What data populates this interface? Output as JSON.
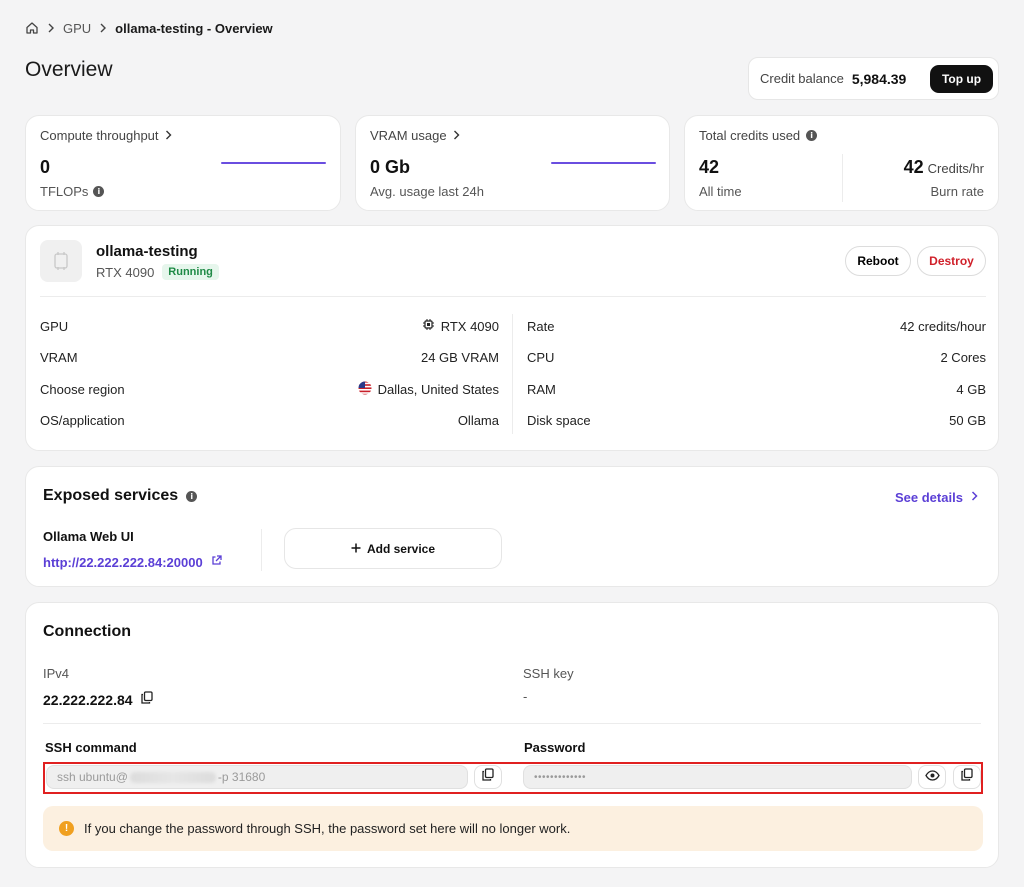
{
  "breadcrumb": {
    "home_icon": "home-icon",
    "level1": "GPU",
    "current": "ollama-testing - Overview"
  },
  "page_title": "Overview",
  "credit": {
    "label": "Credit balance",
    "value": "5,984.39",
    "topup_label": "Top up"
  },
  "stats": {
    "compute": {
      "label": "Compute throughput",
      "value": "0",
      "sub": "TFLOPs"
    },
    "vram": {
      "label": "VRAM usage",
      "value": "0 Gb",
      "sub": "Avg. usage last 24h"
    },
    "credits": {
      "label": "Total credits used",
      "value_all": "42",
      "sub_all": "All time",
      "value_rate": "42",
      "rate_unit": "Credits/hr",
      "sub_rate": "Burn rate"
    }
  },
  "instance": {
    "name": "ollama-testing",
    "model": "RTX 4090",
    "status": "Running",
    "reboot_label": "Reboot",
    "destroy_label": "Destroy",
    "specs_left": [
      {
        "label": "GPU",
        "value": "RTX 4090",
        "icon": "gpu-chip-icon"
      },
      {
        "label": "VRAM",
        "value": "24 GB VRAM"
      },
      {
        "label": "Choose region",
        "value": "Dallas, United States",
        "icon": "us-flag-icon"
      },
      {
        "label": "OS/application",
        "value": "Ollama"
      }
    ],
    "specs_right": [
      {
        "label": "Rate",
        "value": "42 credits/hour"
      },
      {
        "label": "CPU",
        "value": "2 Cores"
      },
      {
        "label": "RAM",
        "value": "4 GB"
      },
      {
        "label": "Disk space",
        "value": "50 GB"
      }
    ]
  },
  "services": {
    "title": "Exposed services",
    "see_details": "See details",
    "service_name": "Ollama Web UI",
    "service_url": "http://22.222.222.84:20000",
    "add_service": "Add service"
  },
  "connection": {
    "title": "Connection",
    "ipv4_label": "IPv4",
    "ipv4_value": "22.222.222.84",
    "ssh_key_label": "SSH key",
    "ssh_key_value": "-",
    "ssh_command_label": "SSH command",
    "ssh_command_prefix": "ssh ubuntu@",
    "ssh_command_suffix": "-p 31680",
    "password_label": "Password",
    "password_value": "•••••••••••••",
    "warning": "If you change the password through SSH, the password set here will no longer work."
  },
  "colors": {
    "accent": "#5b3fd6",
    "running": "#1f8a46",
    "destroy": "#d0202a",
    "warning_bg": "#fcf0e0"
  }
}
